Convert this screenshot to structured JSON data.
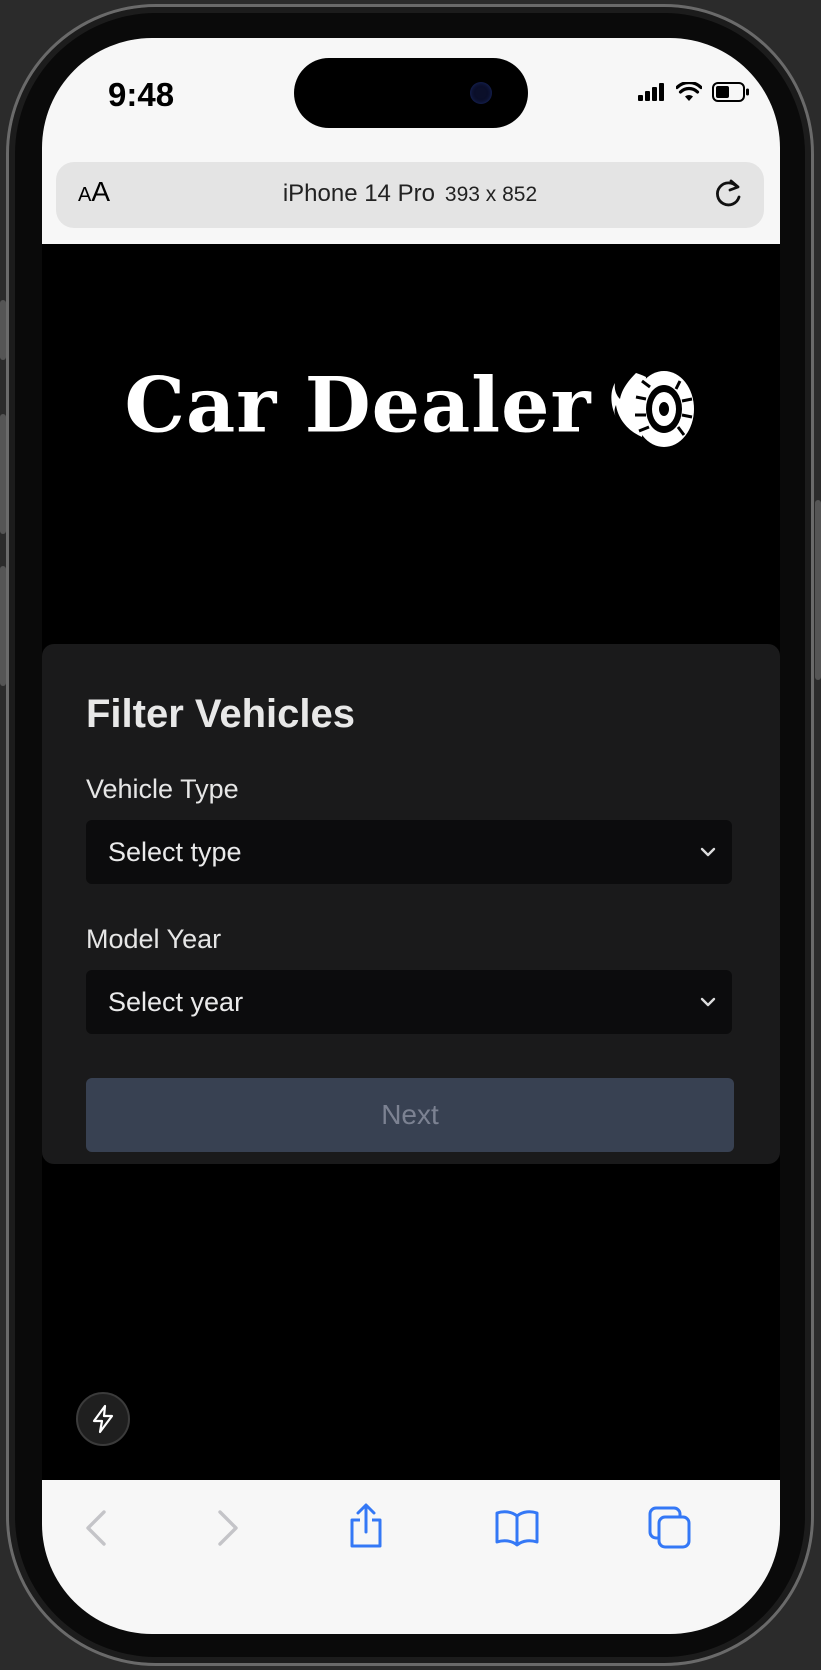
{
  "status_bar": {
    "time": "9:48",
    "icons": [
      "signal-icon",
      "wifi-icon",
      "battery-icon"
    ]
  },
  "url_bar": {
    "text_size_label_small": "A",
    "text_size_label_large": "A",
    "device_name": "iPhone 14 Pro",
    "device_dims": "393 x 852"
  },
  "logo": {
    "title": "Car Dealer",
    "icon": "flaming-tire-icon"
  },
  "filter_card": {
    "title": "Filter Vehicles",
    "vehicle_type_label": "Vehicle Type",
    "vehicle_type_value": "Select type",
    "model_year_label": "Model Year",
    "model_year_value": "Select year",
    "next_label": "Next"
  },
  "toolbar": {
    "icons": [
      "back-icon",
      "forward-icon",
      "share-icon",
      "bookmarks-icon",
      "tabs-icon"
    ]
  },
  "colors": {
    "page_bg": "#000000",
    "card_bg": "#1a1a1b",
    "select_bg": "#0c0c0d",
    "next_bg": "#384152",
    "next_text": "#7c8292",
    "ios_blue": "#3478f6"
  }
}
